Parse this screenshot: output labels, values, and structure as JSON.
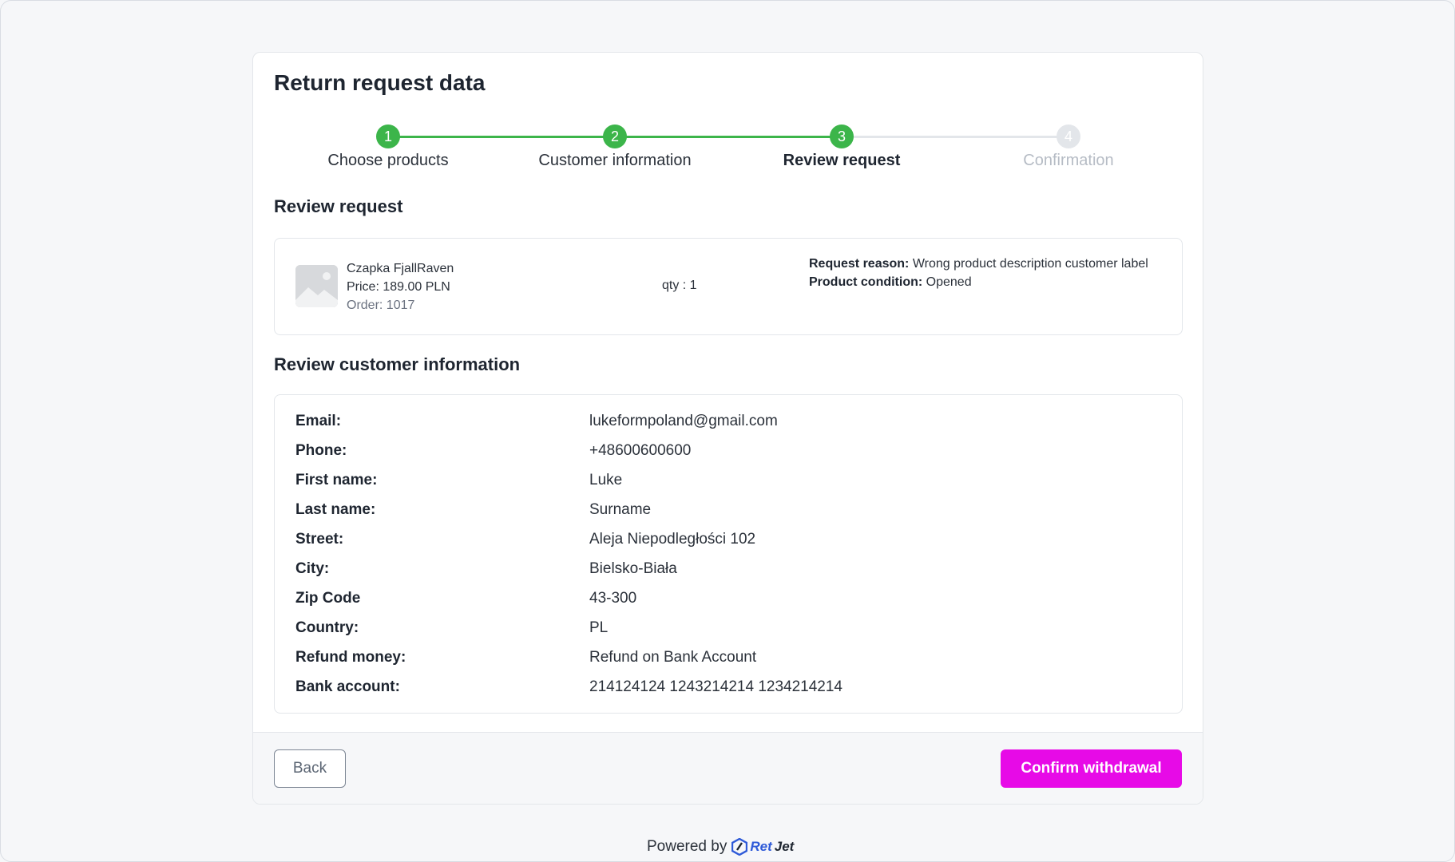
{
  "page": {
    "title": "Return request data"
  },
  "stepper": {
    "steps": [
      {
        "number": "1",
        "label": "Choose products",
        "state": "done"
      },
      {
        "number": "2",
        "label": "Customer information",
        "state": "done"
      },
      {
        "number": "3",
        "label": "Review request",
        "state": "active"
      },
      {
        "number": "4",
        "label": "Confirmation",
        "state": "pending"
      }
    ],
    "colors": {
      "done": "#3cb54a",
      "pending": "#e3e6ea"
    }
  },
  "review_request": {
    "title": "Review request",
    "product": {
      "image_icon": "image-placeholder-icon",
      "name": "Czapka FjallRaven",
      "price": "Price: 189.00 PLN",
      "order": "Order: 1017",
      "qty": "qty : 1",
      "reason_label": "Request reason:",
      "reason_value": "Wrong product description customer label",
      "condition_label": "Product condition:",
      "condition_value": "Opened"
    }
  },
  "customer_info": {
    "title": "Review customer information",
    "rows": [
      {
        "label": "Email:",
        "value": "lukeformpoland@gmail.com"
      },
      {
        "label": "Phone:",
        "value": "+48600600600"
      },
      {
        "label": "First name:",
        "value": "Luke"
      },
      {
        "label": "Last name:",
        "value": "Surname"
      },
      {
        "label": "Street:",
        "value": "Aleja Niepodległości 102"
      },
      {
        "label": "City:",
        "value": "Bielsko-Biała"
      },
      {
        "label": "Zip Code",
        "value": "43-300"
      },
      {
        "label": "Country:",
        "value": "PL"
      },
      {
        "label": "Refund money:",
        "value": "Refund on Bank Account"
      },
      {
        "label": "Bank account:",
        "value": "214124124 1243214214 1234214214"
      }
    ]
  },
  "actions": {
    "back_label": "Back",
    "confirm_label": "Confirm withdrawal",
    "confirm_color": "#e70ae7"
  },
  "footer": {
    "powered_by": "Powered by",
    "brand_ret": "Ret",
    "brand_jet": "Jet",
    "brand_icon": "retjet-logo-icon"
  }
}
